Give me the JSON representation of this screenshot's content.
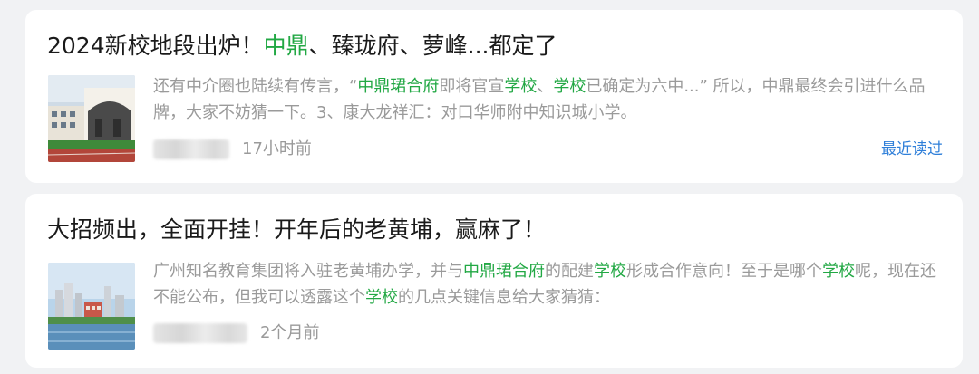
{
  "articles": [
    {
      "title_parts": [
        {
          "text": "2024新校地段出炉！",
          "hl": false
        },
        {
          "text": "中鼎",
          "hl": true
        },
        {
          "text": "、臻珑府、萝峰...都定了",
          "hl": false
        }
      ],
      "snippet_parts": [
        {
          "text": "还有中介圈也陆续有传言，“",
          "hl": false
        },
        {
          "text": "中鼎珺合府",
          "hl": true
        },
        {
          "text": "即将官宣",
          "hl": false
        },
        {
          "text": "学校",
          "hl": true
        },
        {
          "text": "、",
          "hl": false
        },
        {
          "text": "学校",
          "hl": true
        },
        {
          "text": "已确定为六中...” 所以，中鼎最终会引进什么品牌，大家不妨猜一下。3、康大龙祥汇：对口华师附中知识城小学。",
          "hl": false
        }
      ],
      "time": "17小时前",
      "recent_label": "最近读过"
    },
    {
      "title_parts": [
        {
          "text": "大招频出，全面开挂！开年后的老黄埔，赢麻了！",
          "hl": false
        }
      ],
      "snippet_parts": [
        {
          "text": "广州知名教育集团将入驻老黄埔办学，并与",
          "hl": false
        },
        {
          "text": "中鼎珺合府",
          "hl": true
        },
        {
          "text": "的配建",
          "hl": false
        },
        {
          "text": "学校",
          "hl": true
        },
        {
          "text": "形成合作意向！至于是哪个",
          "hl": false
        },
        {
          "text": "学校",
          "hl": true
        },
        {
          "text": "呢，现在还不能公布，但我可以透露这个",
          "hl": false
        },
        {
          "text": "学校",
          "hl": true
        },
        {
          "text": "的几点关键信息给大家猜猜：",
          "hl": false
        }
      ],
      "time": "2个月前"
    }
  ],
  "colors": {
    "highlight": "#22a844",
    "link": "#2f7fd9",
    "snippet": "#9a9a9a",
    "title": "#1a1a1a"
  }
}
